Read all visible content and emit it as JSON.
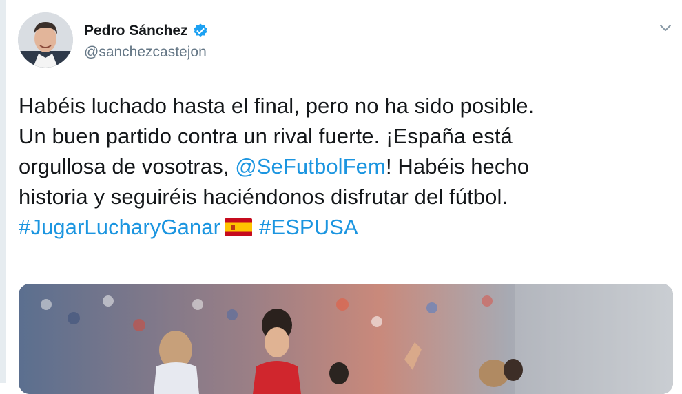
{
  "tweet": {
    "author": {
      "display_name": "Pedro Sánchez",
      "handle": "@sanchezcastejon",
      "verified": true,
      "avatar_icon": "profile-photo"
    },
    "text": {
      "line1": "Habéis luchado hasta el final, pero no ha sido posible.",
      "line2": "Un buen partido contra un rival fuerte. ¡España está",
      "line3_before": "orgullosa de vosotras, ",
      "line3_mention": "@SeFutbolFem",
      "line3_after": "! Habéis hecho",
      "line4": "historia y seguiréis haciéndonos disfrutar del fútbol.",
      "hashtag1": "#JugarLucharyGanar",
      "flag_icon": "spain-flag-emoji",
      "hashtag2": "#ESPUSA"
    },
    "media": {
      "type": "photo",
      "subject": "football-match-photo"
    }
  },
  "colors": {
    "link": "#1b95e0",
    "text": "#14171a",
    "secondary": "#657786",
    "verified": "#1da1f2"
  }
}
